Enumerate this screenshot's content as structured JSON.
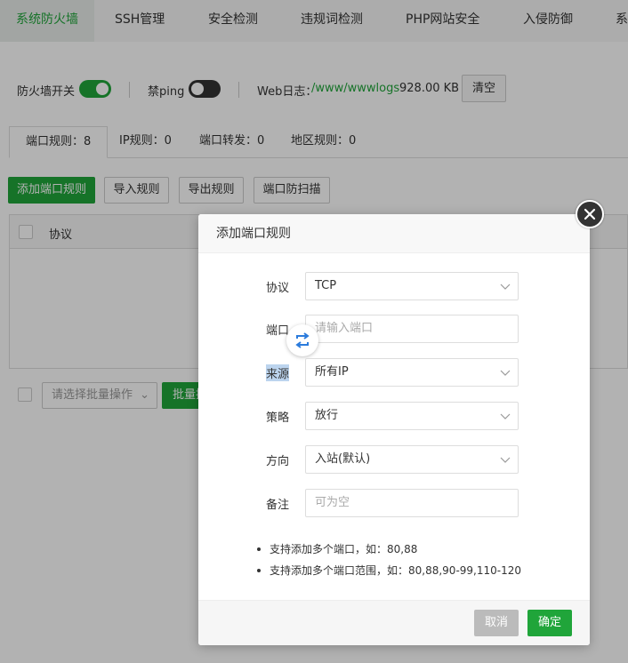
{
  "nav": {
    "tabs": [
      {
        "label": "系统防火墙",
        "active": true
      },
      {
        "label": "SSH管理"
      },
      {
        "label": "安全检测"
      },
      {
        "label": "违规词检测"
      },
      {
        "label": "PHP网站安全"
      },
      {
        "label": "入侵防御"
      },
      {
        "label": "系"
      }
    ]
  },
  "settings": {
    "firewall_label": "防火墙开关",
    "firewall_on": true,
    "ping_label": "禁ping",
    "ping_on": false,
    "weblog_label": "Web日志：",
    "weblog_path": "/www/wwwlogs",
    "weblog_size": "928.00 KB",
    "clear_label": "清空"
  },
  "rule_tabs": [
    {
      "label": "端口规则：8",
      "active": true
    },
    {
      "label": "IP规则：0"
    },
    {
      "label": "端口转发：0"
    },
    {
      "label": "地区规则：0"
    }
  ],
  "actions": {
    "add_port_rule": "添加端口规则",
    "import_rules": "导入规则",
    "export_rules": "导出规则",
    "anti_scan": "端口防扫描"
  },
  "table": {
    "columns": [
      "协议"
    ]
  },
  "bottom": {
    "batch_placeholder": "请选择批量操作",
    "batch_button": "批量操"
  },
  "modal": {
    "title": "添加端口规则",
    "fields": {
      "protocol_label": "协议",
      "protocol_value": "TCP",
      "port_label": "端口",
      "port_placeholder": "请输入端口",
      "source_label": "来源",
      "source_value": "所有IP",
      "policy_label": "策略",
      "policy_value": "放行",
      "direction_label": "方向",
      "direction_value": "入站(默认)",
      "remark_label": "备注",
      "remark_placeholder": "可为空"
    },
    "tips": [
      "支持添加多个端口，如：80,88",
      "支持添加多个端口范围，如：80,88,90-99,110-120"
    ],
    "cancel_label": "取消",
    "ok_label": "确定"
  },
  "colors": {
    "accent": "#20a53a"
  }
}
